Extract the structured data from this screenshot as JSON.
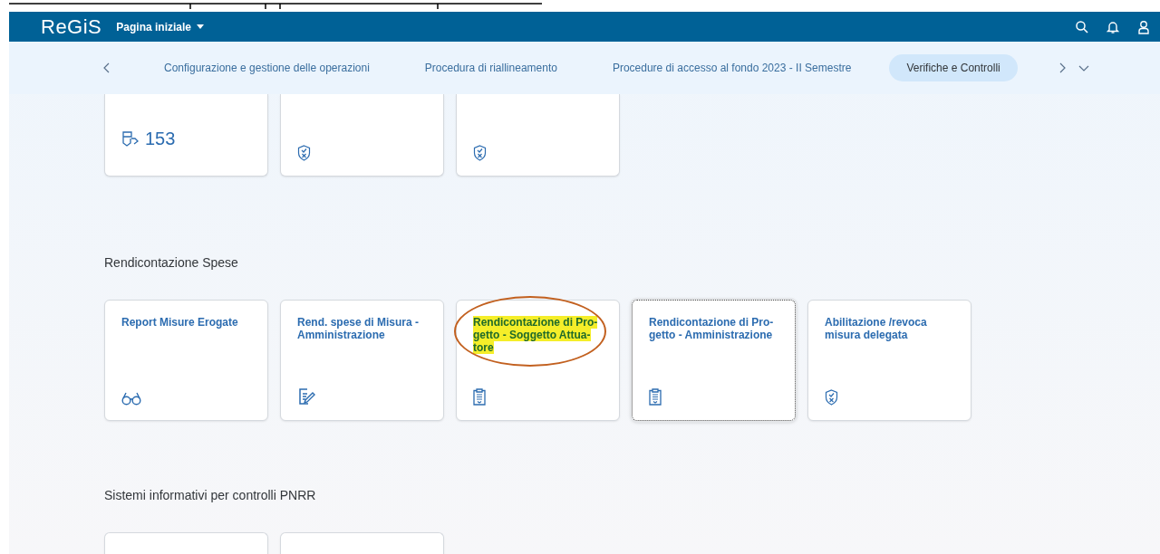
{
  "header": {
    "logo": "ReGiS",
    "menu": "Pagina iniziale"
  },
  "nav": {
    "tabs": [
      {
        "label": "Configurazione e gestione delle operazioni",
        "selected": false
      },
      {
        "label": "Procedura di riallineamento",
        "selected": false
      },
      {
        "label": "Procedure di accesso al fondo 2023 - II Semestre",
        "selected": false
      },
      {
        "label": "Verifiche e Controlli",
        "selected": true
      }
    ]
  },
  "sections": [
    {
      "tiles": [
        {
          "kind": "kpi",
          "kpi": "153",
          "focused": false
        },
        {
          "kind": "shield",
          "focused": false
        },
        {
          "kind": "shield",
          "focused": false
        }
      ]
    },
    {
      "title": "Rendicontazione Spese",
      "tiles": [
        {
          "title": "Report Misure Erogate",
          "kind": "glasses",
          "focused": false,
          "highlighted": false,
          "circled": false
        },
        {
          "title": "Rend. spese di Misura -\nAmministrazione",
          "kind": "edit",
          "focused": false,
          "highlighted": false,
          "circled": false
        },
        {
          "title": "Rendicontazione di Pro-\ngetto - Soggetto Attua-\ntore",
          "kind": "clipboard",
          "focused": false,
          "highlighted": true,
          "circled": true
        },
        {
          "title": "Rendicontazione di Pro-\ngetto - Amministrazione",
          "kind": "clipboard",
          "focused": true,
          "highlighted": false,
          "circled": false
        },
        {
          "title": "Abilitazione /revoca\nmisura delegata",
          "kind": "shield",
          "focused": false,
          "highlighted": false,
          "circled": false
        }
      ]
    },
    {
      "title": "Sistemi informativi per controlli PNRR",
      "tiles": [
        {
          "focused": false
        },
        {
          "focused": false
        }
      ]
    }
  ]
}
